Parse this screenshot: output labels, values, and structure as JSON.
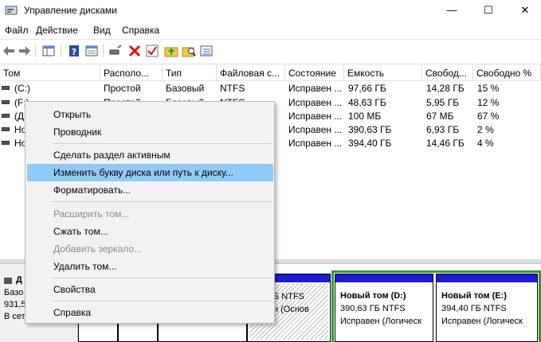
{
  "window": {
    "title": "Управление дисками",
    "minimize_glyph": "—",
    "maximize_glyph": "☐",
    "close_glyph": "✕"
  },
  "menubar": [
    "Файл",
    "Действие",
    "Вид",
    "Справка"
  ],
  "toolbar": {
    "icons": [
      "back-icon",
      "forward-icon",
      "console-tree-icon",
      "help-icon",
      "properties-icon",
      "connect-icon",
      "delete-icon",
      "check-icon",
      "folder-up-icon",
      "folder-search-icon",
      "list-icon"
    ]
  },
  "table": {
    "columns": [
      "Том",
      "Располо...",
      "Тип",
      "Файловая с...",
      "Состояние",
      "Емкость",
      "Свобод...",
      "Свободно %"
    ],
    "rows": [
      [
        "(C:)",
        "Простой",
        "Базовый",
        "NTFS",
        "Исправен ...",
        "97,66 ГБ",
        "14,28 ГБ",
        "15 %"
      ],
      [
        "(F:)",
        "Простой",
        "Базовый",
        "NTFS",
        "Исправен ...",
        "48,63 ГБ",
        "5,95 ГБ",
        "12 %"
      ],
      [
        "(Ди",
        "",
        "",
        "",
        "Исправен ...",
        "100 МБ",
        "67 МБ",
        "67 %"
      ],
      [
        "Но",
        "",
        "",
        "",
        "Исправен ...",
        "390,63 ГБ",
        "6,93 ГБ",
        "2 %"
      ],
      [
        "Но",
        "",
        "",
        "",
        "Исправен ...",
        "394,40 ГБ",
        "14,46 ГБ",
        "4 %"
      ]
    ]
  },
  "disk": {
    "title": "Д",
    "lines": [
      "Базо",
      "931,5",
      "В сет"
    ]
  },
  "partitions": {
    "hatched": {
      "line1": "Б NTFS",
      "line2": "н (Основ"
    },
    "d": {
      "name": "Новый том  (D:)",
      "size": "390,63 ГБ NTFS",
      "status": "Исправен (Логическ"
    },
    "e": {
      "name": "Новый том  (E:)",
      "size": "394,40 ГБ NTFS",
      "status": "Исправен (Логическ"
    }
  },
  "context_menu": {
    "items": [
      {
        "label": "Открыть",
        "enabled": true
      },
      {
        "label": "Проводник",
        "enabled": true
      },
      {
        "label": "Сделать раздел активным",
        "enabled": true
      },
      {
        "label": "Изменить букву диска или путь к диску...",
        "enabled": true,
        "highlighted": true
      },
      {
        "label": "Форматировать...",
        "enabled": true
      },
      {
        "label": "Расширить том...",
        "enabled": false
      },
      {
        "label": "Сжать том...",
        "enabled": true
      },
      {
        "label": "Добавить зеркало...",
        "enabled": false
      },
      {
        "label": "Удалить том...",
        "enabled": true
      },
      {
        "label": "Свойства",
        "enabled": true
      },
      {
        "label": "Справка",
        "enabled": true
      }
    ]
  },
  "colors": {
    "highlight": "#91c9f7",
    "partition_bar": "#1c1cd6",
    "selection_frame": "#2e9a2e"
  }
}
